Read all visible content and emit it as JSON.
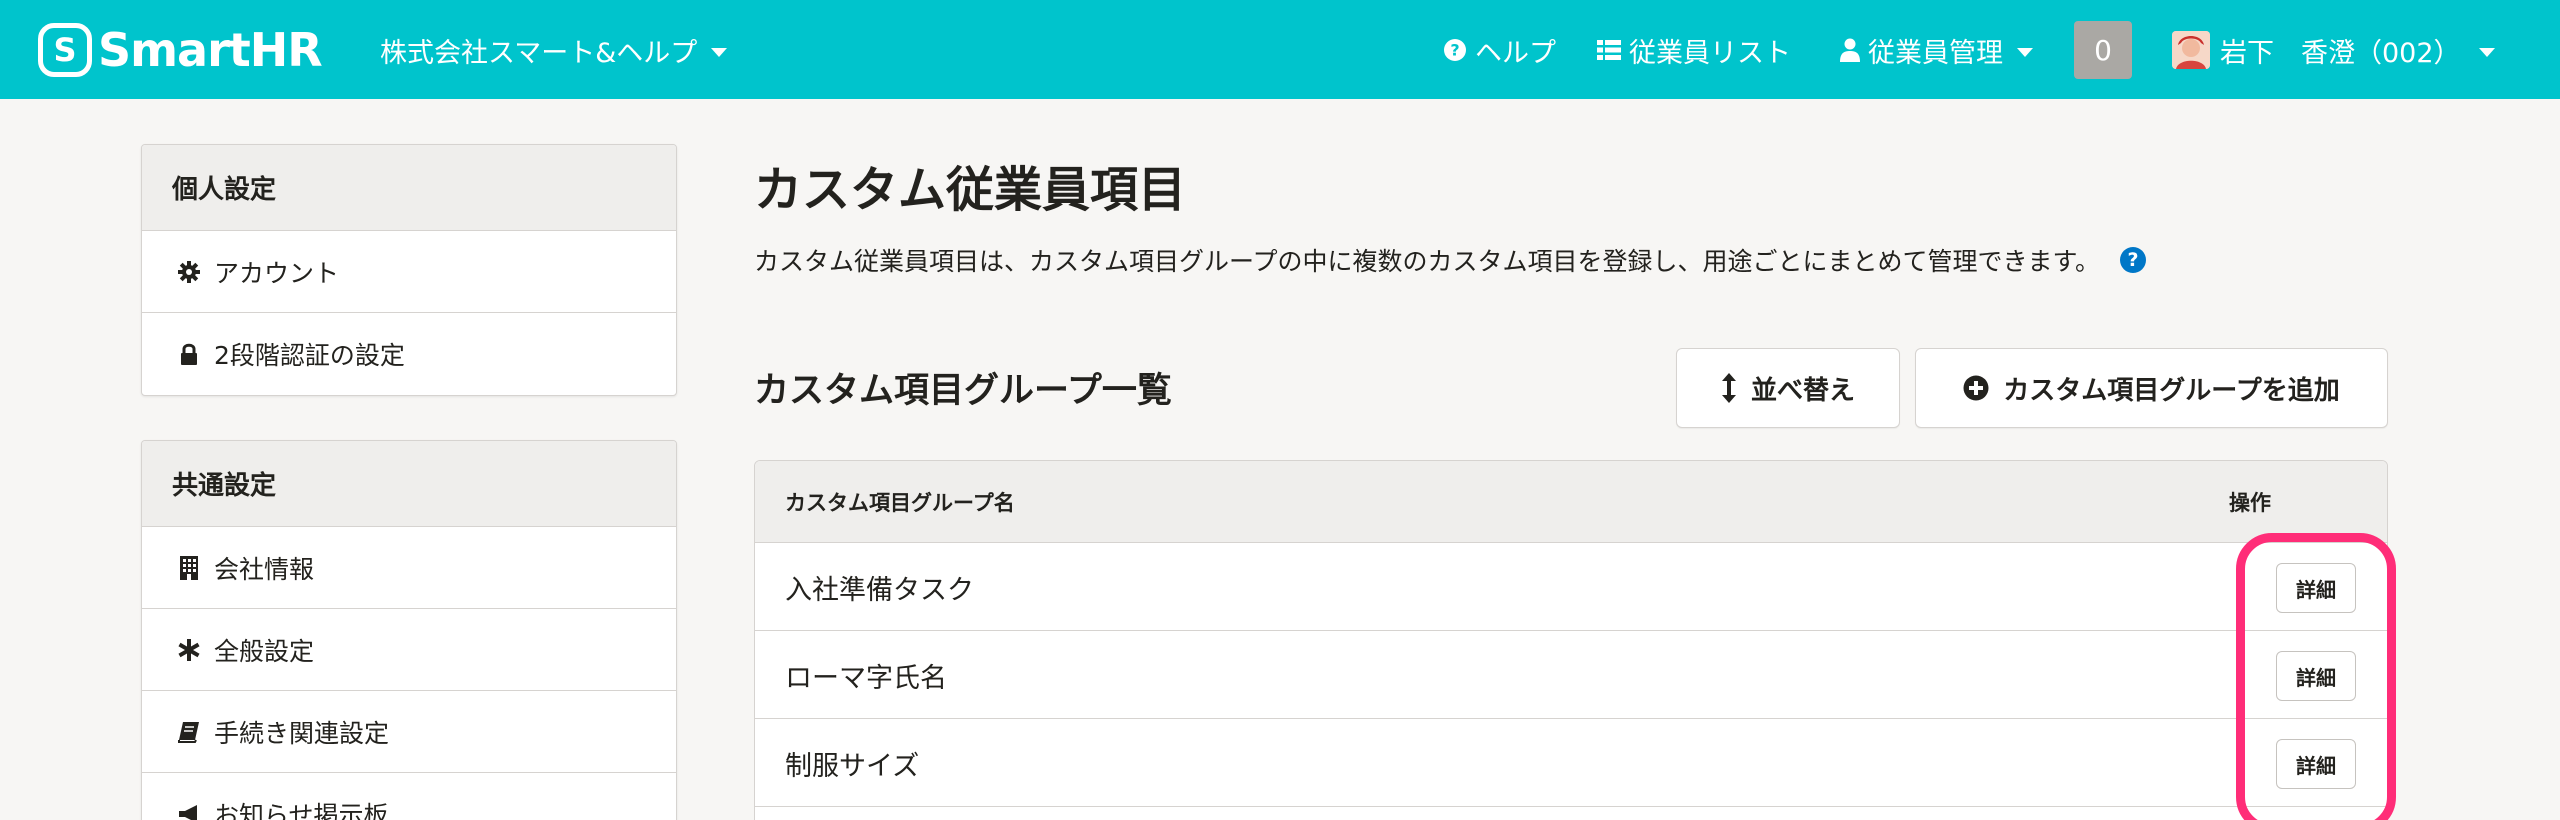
{
  "header": {
    "logo_text": "SmartHR",
    "company_name": "株式会社スマート&ヘルプ",
    "nav": {
      "help": "ヘルプ",
      "employee_list": "従業員リスト",
      "employee_management": "従業員管理"
    },
    "notification_count": "0",
    "user_name": "岩下　香澄（002）"
  },
  "sidebar": {
    "personal": {
      "title": "個人設定",
      "items": [
        {
          "label": "アカウント",
          "icon": "gear-icon"
        },
        {
          "label": "2段階認証の設定",
          "icon": "lock-icon"
        }
      ]
    },
    "common": {
      "title": "共通設定",
      "items": [
        {
          "label": "会社情報",
          "icon": "building-icon"
        },
        {
          "label": "全般設定",
          "icon": "asterisk-icon"
        },
        {
          "label": "手続き関連設定",
          "icon": "book-icon"
        },
        {
          "label": "お知らせ掲示板",
          "icon": "megaphone-icon"
        }
      ]
    }
  },
  "main": {
    "title": "カスタム従業員項目",
    "description": "カスタム従業員項目は、カスタム項目グループの中に複数のカスタム項目を登録し、用途ごとにまとめて管理できます。",
    "section_title": "カスタム項目グループ一覧",
    "sort_button": "並べ替え",
    "add_button": "カスタム項目グループを追加",
    "table": {
      "headers": {
        "name": "カスタム項目グループ名",
        "operations": "操作"
      },
      "rows": [
        {
          "name": "入社準備タスク",
          "action": "詳細"
        },
        {
          "name": "ローマ字氏名",
          "action": "詳細"
        },
        {
          "name": "制服サイズ",
          "action": "詳細"
        }
      ]
    }
  },
  "colors": {
    "header_bg": "#00c4cc",
    "highlight": "#ff2d78",
    "help_icon": "#0077c7"
  }
}
